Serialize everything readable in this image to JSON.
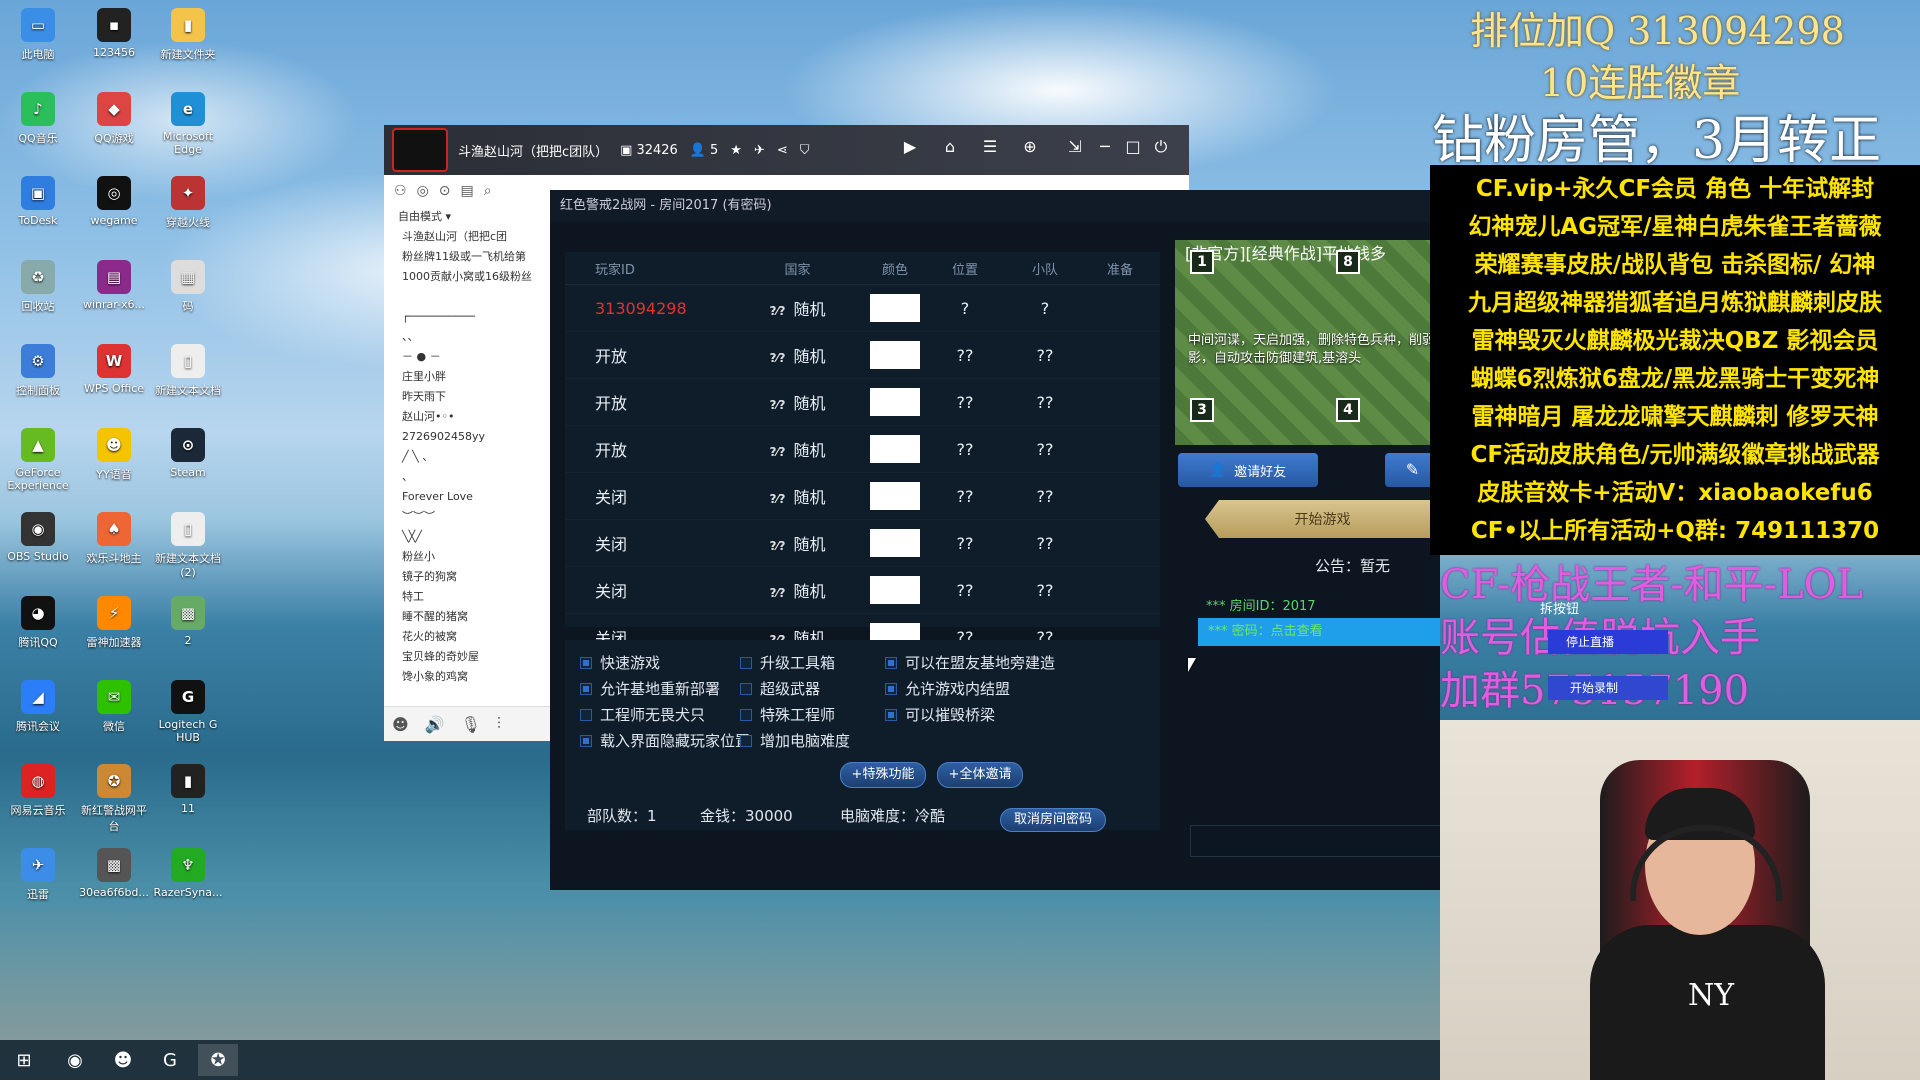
{
  "desktop": {
    "icons": [
      {
        "label": "此电脑",
        "icon": "computer-icon",
        "color": "#3a8ee6",
        "glyph": "▭"
      },
      {
        "label": "123456",
        "icon": "app-icon",
        "color": "#222",
        "glyph": "▪"
      },
      {
        "label": "新建文件夹",
        "icon": "folder-icon",
        "color": "#f3c34a",
        "glyph": "▮"
      },
      {
        "label": "QQ音乐",
        "icon": "qqmusic-icon",
        "color": "#2bbf5b",
        "glyph": "♪"
      },
      {
        "label": "QQ游戏",
        "icon": "qqgame-icon",
        "color": "#d44",
        "glyph": "◆"
      },
      {
        "label": "Microsoft Edge",
        "icon": "edge-icon",
        "color": "#1f8fd6",
        "glyph": "e"
      },
      {
        "label": "ToDesk",
        "icon": "todesk-icon",
        "color": "#2f7de0",
        "glyph": "▣"
      },
      {
        "label": "wegame",
        "icon": "wegame-icon",
        "color": "#111",
        "glyph": "◎"
      },
      {
        "label": "穿越火线",
        "icon": "crossfire-icon",
        "color": "#b33",
        "glyph": "✦"
      },
      {
        "label": "回收站",
        "icon": "recycle-bin-icon",
        "color": "#8aa",
        "glyph": "♻"
      },
      {
        "label": "winrar-x6...",
        "icon": "winrar-icon",
        "color": "#8b2a8b",
        "glyph": "▤"
      },
      {
        "label": "码",
        "icon": "file-icon",
        "color": "#ddd",
        "glyph": "▦"
      },
      {
        "label": "控制面板",
        "icon": "control-panel-icon",
        "color": "#3b7dd8",
        "glyph": "⚙"
      },
      {
        "label": "WPS Office",
        "icon": "wps-icon",
        "color": "#d33",
        "glyph": "W"
      },
      {
        "label": "新建文本文档",
        "icon": "text-file-icon",
        "color": "#eee",
        "glyph": "▯"
      },
      {
        "label": "GeForce Experience",
        "icon": "geforce-icon",
        "color": "#6b2",
        "glyph": "▲"
      },
      {
        "label": "YY语音",
        "icon": "yy-icon",
        "color": "#f5c400",
        "glyph": "☻"
      },
      {
        "label": "Steam",
        "icon": "steam-icon",
        "color": "#1b2838",
        "glyph": "⊙"
      },
      {
        "label": "OBS Studio",
        "icon": "obs-icon",
        "color": "#333",
        "glyph": "◉"
      },
      {
        "label": "欢乐斗地主",
        "icon": "doudizhu-icon",
        "color": "#e63",
        "glyph": "♠"
      },
      {
        "label": "新建文本文档 (2)",
        "icon": "text-file-icon",
        "color": "#eee",
        "glyph": "▯"
      },
      {
        "label": "腾讯QQ",
        "icon": "qq-icon",
        "color": "#111",
        "glyph": "◕"
      },
      {
        "label": "雷神加速器",
        "icon": "thor-icon",
        "color": "#f80",
        "glyph": "⚡"
      },
      {
        "label": "2",
        "icon": "image-file-icon",
        "color": "#6a6",
        "glyph": "▩"
      },
      {
        "label": "腾讯会议",
        "icon": "tencent-meeting-icon",
        "color": "#2c7ef8",
        "glyph": "◢"
      },
      {
        "label": "微信",
        "icon": "wechat-icon",
        "color": "#2dc100",
        "glyph": "✉"
      },
      {
        "label": "Logitech G HUB",
        "icon": "logitech-icon",
        "color": "#111",
        "glyph": "G"
      },
      {
        "label": "网易云音乐",
        "icon": "netease-music-icon",
        "color": "#d22",
        "glyph": "◍"
      },
      {
        "label": "新红警战网平台",
        "icon": "red-alert-icon",
        "color": "#c83",
        "glyph": "✪"
      },
      {
        "label": "11",
        "icon": "phone-file-icon",
        "color": "#222",
        "glyph": "▮"
      },
      {
        "label": "迅雷",
        "icon": "xunlei-icon",
        "color": "#3b8de8",
        "glyph": "✈"
      },
      {
        "label": "30ea6f6bd...",
        "icon": "image-file-icon",
        "color": "#555",
        "glyph": "▩"
      },
      {
        "label": "RazerSyna...",
        "icon": "razer-icon",
        "color": "#2a2",
        "glyph": "♆"
      }
    ]
  },
  "douyu": {
    "channel_title": "斗渔赵山河（把把c团队）",
    "room_no": "32426",
    "viewers": "5",
    "mode_label": "自由模式",
    "list": [
      "斗渔赵山河（把把c团",
      "粉丝牌11级或一飞机给第",
      "1000贡献小窝或16级粉丝",
      "",
      "┌──────────",
      "、、",
      "－  ●  －",
      "庄里小胖",
      "昨天雨下",
      "赵山河•◦•",
      "2726902458yy",
      "╱ ╲ 、",
      "、",
      "Forever  Love",
      "︶︶︶",
      "╲╳╱",
      "粉丝小",
      "镜子的狗窝",
      "特工",
      "睡不醒的猪窝",
      "花火的被窝",
      "宝贝蜂的奇妙屋",
      "馋小象的鸡窝"
    ]
  },
  "room": {
    "title": "红色警戒2战网 - 房间2017 (有密码)",
    "headers": [
      "玩家ID",
      "国家",
      "颜色",
      "位置",
      "小队",
      "准备"
    ],
    "rows": [
      {
        "id": "313094298",
        "country": "随机",
        "pos": "?",
        "team": "?",
        "highlight": true
      },
      {
        "id": "开放",
        "country": "随机",
        "pos": "??",
        "team": "??"
      },
      {
        "id": "开放",
        "country": "随机",
        "pos": "??",
        "team": "??"
      },
      {
        "id": "开放",
        "country": "随机",
        "pos": "??",
        "team": "??"
      },
      {
        "id": "关闭",
        "country": "随机",
        "pos": "??",
        "team": "??"
      },
      {
        "id": "关闭",
        "country": "随机",
        "pos": "??",
        "team": "??"
      },
      {
        "id": "关闭",
        "country": "随机",
        "pos": "??",
        "team": "??"
      },
      {
        "id": "关闭",
        "country": "随机",
        "pos": "??",
        "team": "??"
      }
    ],
    "flag_glyph": "?⁄?",
    "options": [
      {
        "label": "快速游戏",
        "on": true
      },
      {
        "label": "升级工具箱",
        "on": false
      },
      {
        "label": "可以在盟友基地旁建造",
        "on": true
      },
      {
        "label": "允许基地重新部署",
        "on": true
      },
      {
        "label": "超级武器",
        "on": false
      },
      {
        "label": "允许游戏内结盟",
        "on": true
      },
      {
        "label": "工程师无畏犬只",
        "on": false
      },
      {
        "label": "特殊工程师",
        "on": false
      },
      {
        "label": "可以摧毁桥梁",
        "on": true
      },
      {
        "label": "载入界面隐藏玩家位置",
        "on": true
      },
      {
        "label": "增加电脑难度",
        "on": false
      }
    ],
    "special_btn": "+特殊功能",
    "invite_all_btn": "+全体邀请",
    "units": "部队数：1",
    "money": "金钱：30000",
    "ai": "电脑难度：冷酷",
    "cancel_pw_btn": "取消房间密码",
    "map_title": "[非官方][经典作战]平地钱多",
    "map_desc": "中间河谍，天启加强，删除特色兵种，削弱幻影，自动攻击防御建筑,基溶头",
    "invite_friend_btn": "邀请好友",
    "start_btn": "开始游戏",
    "notice": "公告：暂无",
    "room_id_line": "*** 房间ID：2017",
    "pw_line": "*** 密码：点击查看"
  },
  "overlay": {
    "top1": "排位加Q  313094298",
    "top2": "10连胜徽章",
    "top3": "钻粉房管，3月转正",
    "yellow": [
      "CF.vip+永久CF会员 角色 十年试解封",
      "幻神宠儿AG冠军/星神白虎朱雀王者蔷薇",
      "荣耀赛事皮肤/战队背包 击杀图标/ 幻神",
      "九月超级神器猎狐者追月炼狱麒麟刺皮肤",
      "雷神毁灭火麒麟极光裁决QBZ 影视会员",
      "蝴蝶6烈炼狱6盘龙/黑龙黑骑士干变死神",
      "雷神暗月 屠龙龙啸擎天麒麟刺 修罗天神",
      "CF活动皮肤角色/元帅满级徽章挑战武器",
      "皮肤音效卡+活动V：xiaobaokefu6",
      "CF•以上所有活动+Q群: 749111370"
    ],
    "pink1": "CF-枪战王者-和平-LOL",
    "pink2": "账号估值脱坑入手",
    "pink3": "加群575157190",
    "stream_btn1": "拆按钮",
    "stream_btn2": "停止直播",
    "stream_btn3": "开始录制"
  }
}
